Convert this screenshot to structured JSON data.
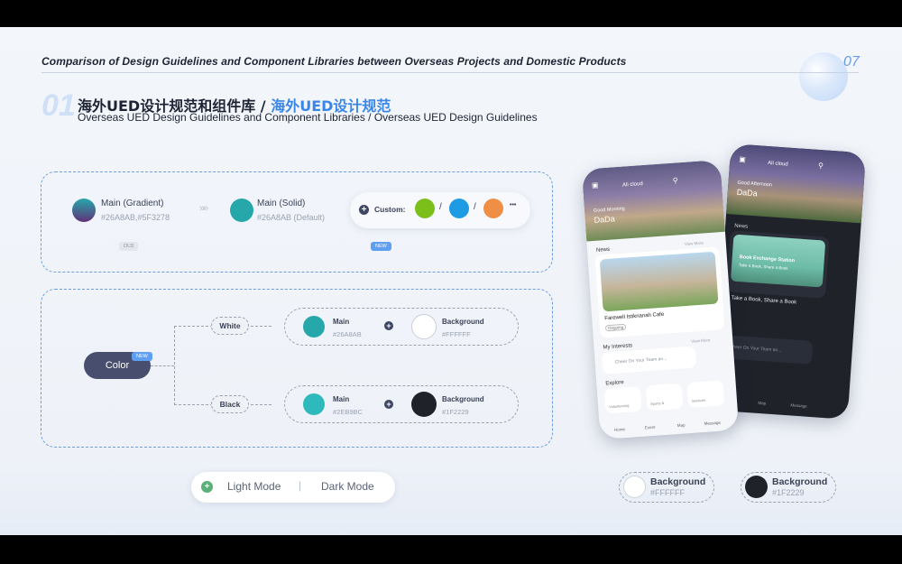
{
  "header": {
    "title": "Comparison of Design Guidelines and Component Libraries between Overseas Projects and Domestic Products",
    "page": "07"
  },
  "section": {
    "number": "01",
    "title_cn": "海外UED设计规范和组件库 /",
    "title_cn_highlight": "海外UED设计规范",
    "subtitle": "Overseas UED Design Guidelines and Component Libraries / Overseas UED Design Guidelines"
  },
  "main_colors": {
    "gradient": {
      "label": "Main (Gradient)",
      "hex": "#26A8AB,#5F3278",
      "tag": "OLD"
    },
    "solid": {
      "label": "Main (Solid)",
      "hex": "#26A8AB (Default)",
      "tag": "NEW"
    },
    "custom": {
      "label": "Custom:",
      "sep1": "/",
      "sep2": "/",
      "more": "•••"
    }
  },
  "color_tree": {
    "root": "Color",
    "root_tag": "NEW",
    "white": {
      "branch": "White",
      "main_label": "Main",
      "main_hex": "#26A8AB",
      "bg_label": "Background",
      "bg_hex": "#FFFFFF"
    },
    "black": {
      "branch": "Black",
      "main_label": "Main",
      "main_hex": "#2EB9BC",
      "bg_label": "Background",
      "bg_hex": "#1F2229"
    }
  },
  "mode_toggle": {
    "light": "Light Mode",
    "divider": "|",
    "dark": "Dark Mode"
  },
  "bg_swatches": [
    {
      "label": "Background",
      "hex": "#FFFFFF"
    },
    {
      "label": "Background",
      "hex": "#1F2229"
    }
  ],
  "phone_light": {
    "location": "Ali cloud",
    "greeting": "Good Morning",
    "name": "DaDa",
    "news": "News",
    "view_more": "View More",
    "card_title": "Farewell Istiknanah Cafe",
    "card_tag": "Ongoing",
    "interests": "My Interests",
    "interest_item": "Cheer On Your Team an...",
    "explore": "Explore",
    "explore_items": [
      "Volunteering",
      "Sports &",
      "Services"
    ],
    "nav": [
      "Home",
      "Event",
      "Map",
      "Message"
    ]
  },
  "phone_dark": {
    "location": "Ali cloud",
    "greeting": "Good Afternoon",
    "name": "DaDa",
    "news": "News",
    "card_title": "Book Exchange Station",
    "card_sub": "Take a Book, Share a Book",
    "caption": "Take a Book, Share a Book",
    "interest_item": "Cheer On Your Team an...",
    "nav": [
      "Map",
      "Message"
    ]
  },
  "colors": {
    "teal": "#26A8AB",
    "teal_dark": "#2EB9BC",
    "purple": "#5F3278",
    "green": "#7DBF1A",
    "blue": "#1E9BE3",
    "orange": "#EE8F45",
    "dark_bg": "#1F2229"
  }
}
